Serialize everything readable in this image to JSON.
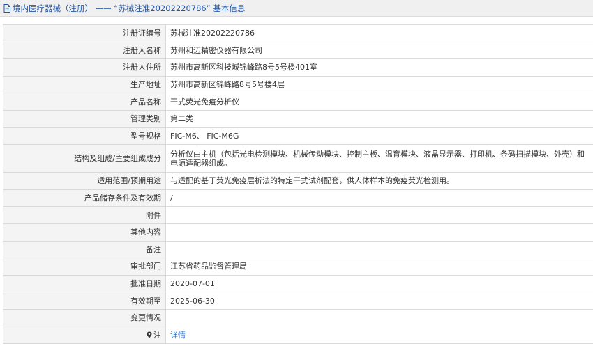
{
  "header": {
    "title": "境内医疗器械（注册）  ——  “苏械注准20202220786” 基本信息"
  },
  "rows": [
    {
      "label": "注册证编号",
      "value": "苏械注准20202220786"
    },
    {
      "label": "注册人名称",
      "value": "苏州和迈精密仪器有限公司"
    },
    {
      "label": "注册人住所",
      "value": "苏州市高新区科技城锦峰路8号5号楼401室"
    },
    {
      "label": "生产地址",
      "value": "苏州市高新区锦峰路8号5号楼4层"
    },
    {
      "label": "产品名称",
      "value": "干式荧光免疫分析仪"
    },
    {
      "label": "管理类别",
      "value": "第二类"
    },
    {
      "label": "型号规格",
      "value": "FIC-M6、 FIC-M6G"
    },
    {
      "label": "结构及组成/主要组成成分",
      "value": "分析仪由主机（包括光电检测模块、机械传动模块、控制主板、温育模块、液晶显示器、打印机、条码扫描模块、外壳）和电源适配器组成。"
    },
    {
      "label": "适用范围/预期用途",
      "value": "与适配的基于荧光免疫层析法的特定干式试剂配套，供人体样本的免疫荧光检测用。"
    },
    {
      "label": "产品储存条件及有效期",
      "value": "/"
    },
    {
      "label": "附件",
      "value": ""
    },
    {
      "label": "其他内容",
      "value": ""
    },
    {
      "label": "备注",
      "value": ""
    },
    {
      "label": "审批部门",
      "value": "江苏省药品监督管理局"
    },
    {
      "label": "批准日期",
      "value": "2020-07-01"
    },
    {
      "label": "有效期至",
      "value": "2025-06-30"
    },
    {
      "label": "变更情况",
      "value": ""
    }
  ],
  "note_row": {
    "label": "注",
    "link_text": "详情"
  },
  "icons": {
    "title": "document-icon",
    "note": "pin-icon"
  },
  "colors": {
    "title_text": "#2255a4",
    "link": "#2a6fcb",
    "label_bg": "#f4f4f4",
    "border": "#d9d9d9"
  }
}
